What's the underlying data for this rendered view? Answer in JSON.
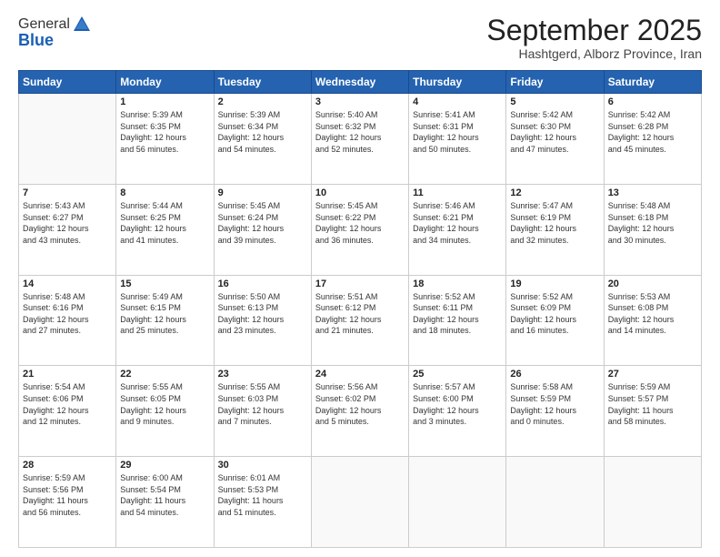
{
  "logo": {
    "line1": "General",
    "line2": "Blue"
  },
  "header": {
    "month_year": "September 2025",
    "location": "Hashtgerd, Alborz Province, Iran"
  },
  "weekdays": [
    "Sunday",
    "Monday",
    "Tuesday",
    "Wednesday",
    "Thursday",
    "Friday",
    "Saturday"
  ],
  "weeks": [
    [
      {
        "day": "",
        "info": ""
      },
      {
        "day": "1",
        "info": "Sunrise: 5:39 AM\nSunset: 6:35 PM\nDaylight: 12 hours\nand 56 minutes."
      },
      {
        "day": "2",
        "info": "Sunrise: 5:39 AM\nSunset: 6:34 PM\nDaylight: 12 hours\nand 54 minutes."
      },
      {
        "day": "3",
        "info": "Sunrise: 5:40 AM\nSunset: 6:32 PM\nDaylight: 12 hours\nand 52 minutes."
      },
      {
        "day": "4",
        "info": "Sunrise: 5:41 AM\nSunset: 6:31 PM\nDaylight: 12 hours\nand 50 minutes."
      },
      {
        "day": "5",
        "info": "Sunrise: 5:42 AM\nSunset: 6:30 PM\nDaylight: 12 hours\nand 47 minutes."
      },
      {
        "day": "6",
        "info": "Sunrise: 5:42 AM\nSunset: 6:28 PM\nDaylight: 12 hours\nand 45 minutes."
      }
    ],
    [
      {
        "day": "7",
        "info": "Sunrise: 5:43 AM\nSunset: 6:27 PM\nDaylight: 12 hours\nand 43 minutes."
      },
      {
        "day": "8",
        "info": "Sunrise: 5:44 AM\nSunset: 6:25 PM\nDaylight: 12 hours\nand 41 minutes."
      },
      {
        "day": "9",
        "info": "Sunrise: 5:45 AM\nSunset: 6:24 PM\nDaylight: 12 hours\nand 39 minutes."
      },
      {
        "day": "10",
        "info": "Sunrise: 5:45 AM\nSunset: 6:22 PM\nDaylight: 12 hours\nand 36 minutes."
      },
      {
        "day": "11",
        "info": "Sunrise: 5:46 AM\nSunset: 6:21 PM\nDaylight: 12 hours\nand 34 minutes."
      },
      {
        "day": "12",
        "info": "Sunrise: 5:47 AM\nSunset: 6:19 PM\nDaylight: 12 hours\nand 32 minutes."
      },
      {
        "day": "13",
        "info": "Sunrise: 5:48 AM\nSunset: 6:18 PM\nDaylight: 12 hours\nand 30 minutes."
      }
    ],
    [
      {
        "day": "14",
        "info": "Sunrise: 5:48 AM\nSunset: 6:16 PM\nDaylight: 12 hours\nand 27 minutes."
      },
      {
        "day": "15",
        "info": "Sunrise: 5:49 AM\nSunset: 6:15 PM\nDaylight: 12 hours\nand 25 minutes."
      },
      {
        "day": "16",
        "info": "Sunrise: 5:50 AM\nSunset: 6:13 PM\nDaylight: 12 hours\nand 23 minutes."
      },
      {
        "day": "17",
        "info": "Sunrise: 5:51 AM\nSunset: 6:12 PM\nDaylight: 12 hours\nand 21 minutes."
      },
      {
        "day": "18",
        "info": "Sunrise: 5:52 AM\nSunset: 6:11 PM\nDaylight: 12 hours\nand 18 minutes."
      },
      {
        "day": "19",
        "info": "Sunrise: 5:52 AM\nSunset: 6:09 PM\nDaylight: 12 hours\nand 16 minutes."
      },
      {
        "day": "20",
        "info": "Sunrise: 5:53 AM\nSunset: 6:08 PM\nDaylight: 12 hours\nand 14 minutes."
      }
    ],
    [
      {
        "day": "21",
        "info": "Sunrise: 5:54 AM\nSunset: 6:06 PM\nDaylight: 12 hours\nand 12 minutes."
      },
      {
        "day": "22",
        "info": "Sunrise: 5:55 AM\nSunset: 6:05 PM\nDaylight: 12 hours\nand 9 minutes."
      },
      {
        "day": "23",
        "info": "Sunrise: 5:55 AM\nSunset: 6:03 PM\nDaylight: 12 hours\nand 7 minutes."
      },
      {
        "day": "24",
        "info": "Sunrise: 5:56 AM\nSunset: 6:02 PM\nDaylight: 12 hours\nand 5 minutes."
      },
      {
        "day": "25",
        "info": "Sunrise: 5:57 AM\nSunset: 6:00 PM\nDaylight: 12 hours\nand 3 minutes."
      },
      {
        "day": "26",
        "info": "Sunrise: 5:58 AM\nSunset: 5:59 PM\nDaylight: 12 hours\nand 0 minutes."
      },
      {
        "day": "27",
        "info": "Sunrise: 5:59 AM\nSunset: 5:57 PM\nDaylight: 11 hours\nand 58 minutes."
      }
    ],
    [
      {
        "day": "28",
        "info": "Sunrise: 5:59 AM\nSunset: 5:56 PM\nDaylight: 11 hours\nand 56 minutes."
      },
      {
        "day": "29",
        "info": "Sunrise: 6:00 AM\nSunset: 5:54 PM\nDaylight: 11 hours\nand 54 minutes."
      },
      {
        "day": "30",
        "info": "Sunrise: 6:01 AM\nSunset: 5:53 PM\nDaylight: 11 hours\nand 51 minutes."
      },
      {
        "day": "",
        "info": ""
      },
      {
        "day": "",
        "info": ""
      },
      {
        "day": "",
        "info": ""
      },
      {
        "day": "",
        "info": ""
      }
    ]
  ]
}
